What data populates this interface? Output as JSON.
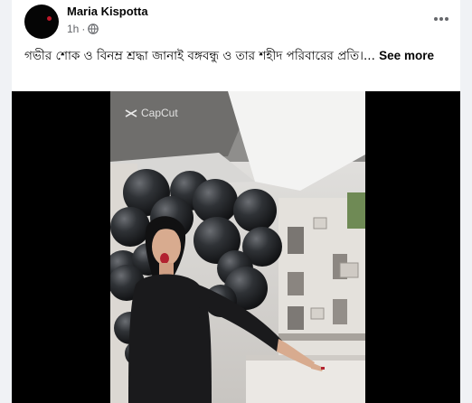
{
  "post": {
    "author": "Maria Kispotta",
    "time": "1h",
    "separator": "·",
    "privacy_icon": "globe-icon",
    "more_icon": "more-horizontal-icon",
    "caption": "গভীর শোক ও বিনম্র শ্রদ্ধা জানাই বঙ্গবন্ধু ও তার শহীদ পরিবারের প্রতি।...",
    "see_more": "See more"
  },
  "media": {
    "watermark": "CapCut",
    "watermark_icon": "capcut-logo-icon"
  },
  "colors": {
    "page_bg": "#f0f2f5",
    "card_bg": "#ffffff",
    "text": "#050505",
    "muted": "#65676b",
    "video_bg": "#000000"
  }
}
